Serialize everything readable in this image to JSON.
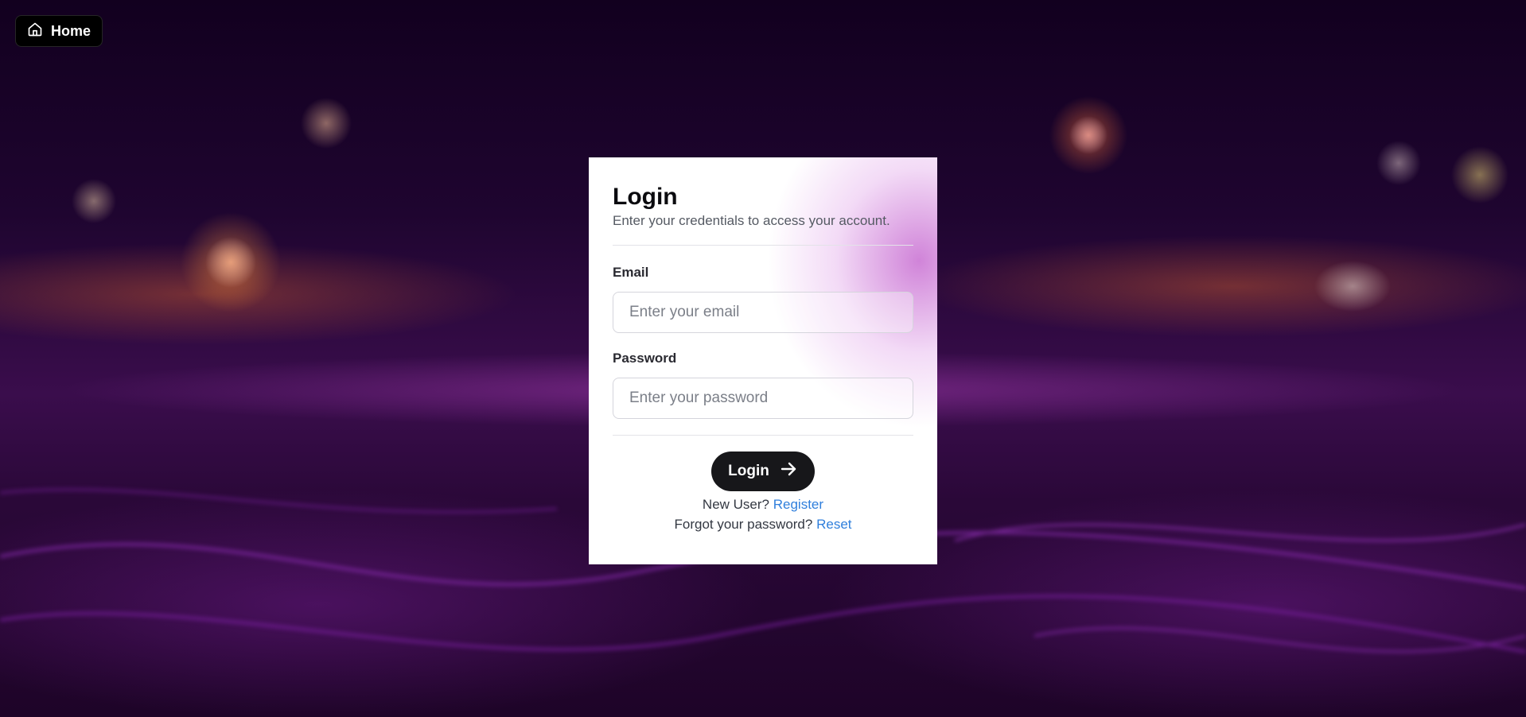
{
  "nav": {
    "home_label": "Home",
    "home_icon": "home-icon"
  },
  "login": {
    "title": "Login",
    "subtitle": "Enter your credentials to access your account.",
    "email_label": "Email",
    "email_placeholder": "Enter your email",
    "email_value": "",
    "password_label": "Password",
    "password_placeholder": "Enter your password",
    "password_value": "",
    "submit_label": "Login",
    "submit_icon": "arrow-right-icon",
    "register_prompt": "New User?",
    "register_link": "Register",
    "reset_prompt": "Forgot your password?",
    "reset_link": "Reset"
  },
  "colors": {
    "link": "#2f7fdc",
    "button_bg": "#17171a",
    "card_bg": "#ffffff",
    "accent_glow": "#c86ed2"
  }
}
